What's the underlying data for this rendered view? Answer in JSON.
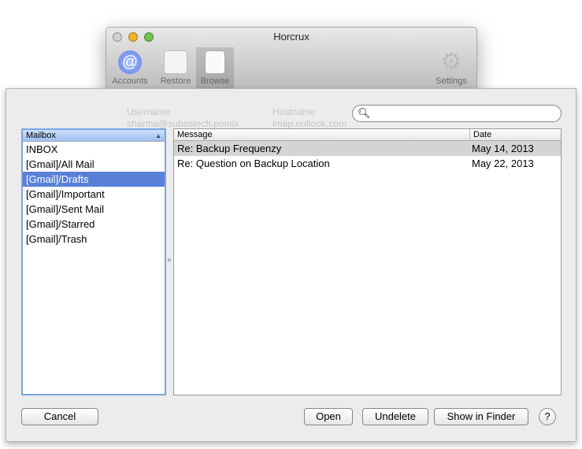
{
  "window": {
    "title": "Horcrux",
    "toolbar": [
      {
        "label": "Accounts",
        "icon": "at-icon"
      },
      {
        "label": "Restore",
        "icon": "switch-icon"
      },
      {
        "label": "Browse",
        "icon": "documents-icon"
      },
      {
        "label": "Settings",
        "icon": "gear-icon"
      }
    ],
    "background_columns": [
      "Username",
      "Hostname"
    ],
    "background_values": [
      "sharma@subastech.pomix",
      "imap.outlook.com"
    ]
  },
  "search": {
    "placeholder": "",
    "value": ""
  },
  "mailbox": {
    "header": "Mailbox",
    "items": [
      "INBOX",
      "[Gmail]/All Mail",
      "[Gmail]/Drafts",
      "[Gmail]/Important",
      "[Gmail]/Sent Mail",
      "[Gmail]/Starred",
      "[Gmail]/Trash"
    ],
    "selected": "[Gmail]/Drafts"
  },
  "messages": {
    "columns": [
      "Message",
      "Date"
    ],
    "rows": [
      {
        "message": "Re: Backup Frequenzy",
        "date": "May 14, 2013"
      },
      {
        "message": "Re: Question on Backup Location",
        "date": "May 22, 2013"
      }
    ]
  },
  "buttons": {
    "cancel": "Cancel",
    "open": "Open",
    "undelete": "Undelete",
    "show_in_finder": "Show in Finder",
    "help": "?"
  },
  "colors": {
    "selection": "#5880d8",
    "row_highlight": "#d4d4d4"
  }
}
